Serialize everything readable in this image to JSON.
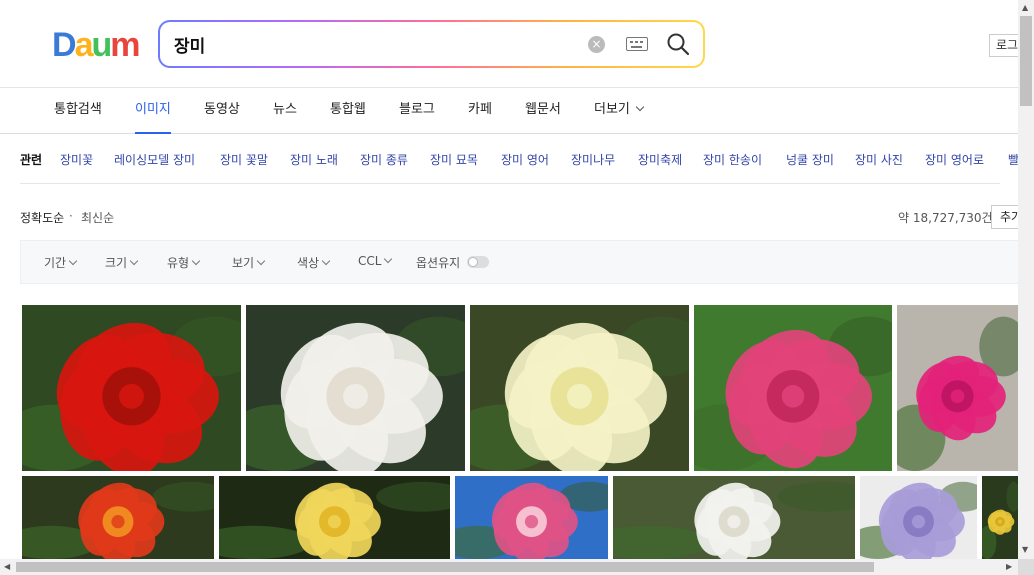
{
  "header": {
    "logo_letters": [
      "D",
      "a",
      "u",
      "m"
    ],
    "logo_colors": [
      "#3a7bd5",
      "#ffb31a",
      "#44c05a",
      "#e8453c"
    ],
    "search_value": "장미",
    "login_label": "로그인"
  },
  "tabs": [
    {
      "label": "통합검색",
      "active": false
    },
    {
      "label": "이미지",
      "active": true
    },
    {
      "label": "동영상",
      "active": false
    },
    {
      "label": "뉴스",
      "active": false
    },
    {
      "label": "통합웹",
      "active": false
    },
    {
      "label": "블로그",
      "active": false
    },
    {
      "label": "카페",
      "active": false
    },
    {
      "label": "웹문서",
      "active": false
    },
    {
      "label": "더보기",
      "active": false
    }
  ],
  "related": {
    "title": "관련",
    "links": [
      "장미꽃",
      "레이싱모델 장미",
      "장미 꽃말",
      "장미 노래",
      "장미 종류",
      "장미 묘목",
      "장미 영어",
      "장미나무",
      "장미축제",
      "장미 한송이",
      "넝쿨 장미",
      "장미 사진",
      "장미 영어로",
      "빨간"
    ]
  },
  "sort": {
    "accuracy": "정확도순",
    "dot": "·",
    "latest": "최신순",
    "result_count": "약 18,727,730건",
    "add_label": "추가"
  },
  "filters": [
    "기간",
    "크기",
    "유형",
    "보기",
    "색상",
    "CCL",
    "옵션유지"
  ],
  "images": [
    {
      "name": "red-rose",
      "bg": "#2f4a22",
      "petal": "#d8160f",
      "center": "#a8100a"
    },
    {
      "name": "white-rose",
      "bg": "#2c3a2a",
      "petal": "#f1f0ea",
      "center": "#e3ddd2"
    },
    {
      "name": "cream-rose",
      "bg": "#3b4826",
      "petal": "#f4f2c6",
      "center": "#e9e39a"
    },
    {
      "name": "pink-rosebuds",
      "bg": "#3f7a2e",
      "petal": "#e2437a",
      "center": "#c52a5f"
    },
    {
      "name": "magenta-rose",
      "bg": "#b9b5ad",
      "petal": "#e3227a",
      "center": "#c01563"
    },
    {
      "name": "orange-red-rose",
      "bg": "#2d3a1e",
      "petal": "#e03a1a",
      "center": "#f08a20"
    },
    {
      "name": "yellow-rose",
      "bg": "#1f2a14",
      "petal": "#f0d65a",
      "center": "#e3b82a"
    },
    {
      "name": "pink-rose-sky",
      "bg": "#2f6fc7",
      "petal": "#e05285",
      "center": "#f6c0d0"
    },
    {
      "name": "white-rose-garden",
      "bg": "#4a5a35",
      "petal": "#f2f2ee",
      "center": "#dedccf"
    },
    {
      "name": "lavender-rose",
      "bg": "#ececec",
      "petal": "#a89cd8",
      "center": "#8a7cc4"
    },
    {
      "name": "yellow-rose-partial",
      "bg": "#2a3a1c",
      "petal": "#e8c53a",
      "center": "#d6a820"
    }
  ]
}
